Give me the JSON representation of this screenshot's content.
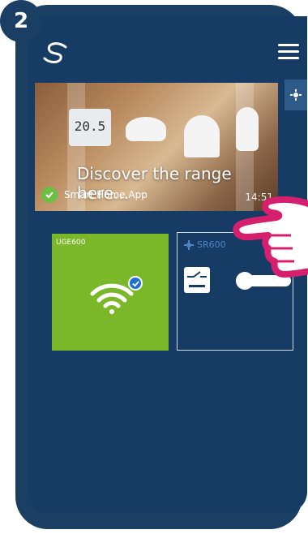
{
  "step": {
    "number": "2"
  },
  "header": {
    "logo_icon": "salus-logo-icon",
    "menu_icon": "hamburger-menu-icon"
  },
  "banner": {
    "title": "Discover the range here...",
    "app_label": "Smart Home App",
    "time": "14:51",
    "thermostat_display": "20.5"
  },
  "tiles": {
    "gateway": {
      "label": "UGE600",
      "icon": "wifi-icon",
      "status_icon": "check-circle-icon"
    },
    "relay": {
      "label": "SR600",
      "icon": "switch-relay-icon",
      "close": "✕",
      "toggle_state": "on"
    }
  },
  "colors": {
    "background": "#163b64",
    "green_tile": "#7ab829",
    "check_green": "#6cbe45",
    "accent_blue": "#4f86c6",
    "hand_outline": "#d61f6d"
  }
}
